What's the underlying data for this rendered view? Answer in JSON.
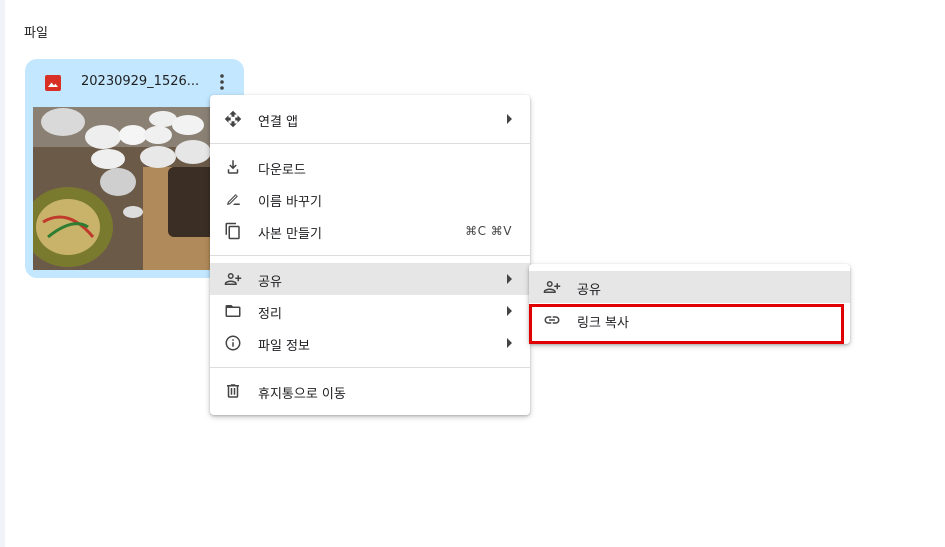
{
  "section": {
    "title": "파일"
  },
  "file": {
    "name": "20230929_1526..."
  },
  "context_menu": {
    "items": [
      {
        "label": "연결 앱",
        "icon": "open-with-icon"
      },
      {
        "label": "다운로드",
        "icon": "download-icon"
      },
      {
        "label": "이름 바꾸기",
        "icon": "rename-icon"
      },
      {
        "label": "사본 만들기",
        "icon": "copy-icon",
        "shortcut": "⌘C ⌘V"
      },
      {
        "label": "공유",
        "icon": "person-add-icon"
      },
      {
        "label": "정리",
        "icon": "folder-icon"
      },
      {
        "label": "파일 정보",
        "icon": "info-icon"
      },
      {
        "label": "휴지통으로 이동",
        "icon": "trash-icon"
      }
    ]
  },
  "share_submenu": {
    "items": [
      {
        "label": "공유",
        "icon": "person-add-icon"
      },
      {
        "label": "링크 복사",
        "icon": "link-icon"
      }
    ]
  },
  "colors": {
    "card_bg": "#c2e7ff",
    "highlight": "#e00000",
    "file_icon": "#d93025"
  }
}
